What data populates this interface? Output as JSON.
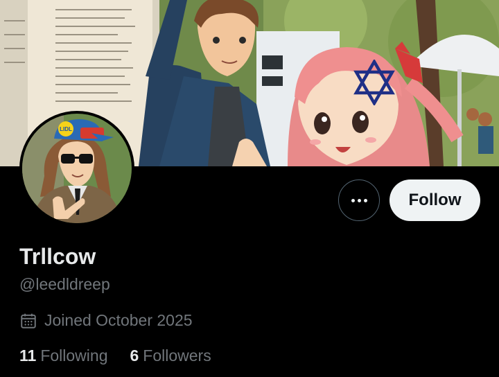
{
  "banner": {
    "alt": ""
  },
  "profile": {
    "display_name": "Trllcow",
    "handle": "@leedldreep",
    "joined": "Joined October 2025",
    "following_count": "11",
    "following_label": "Following",
    "followers_count": "6",
    "followers_label": "Followers"
  },
  "actions": {
    "more_icon": "more-horizontal-icon",
    "follow_label": "Follow"
  },
  "colors": {
    "background": "#000000",
    "primary_text": "#e7e9ea",
    "secondary_text": "#71767b",
    "follow_button_bg": "#eff3f4",
    "follow_button_text": "#0f1419"
  },
  "icons": {
    "calendar": "calendar-icon",
    "star_of_david": "star-of-david-icon"
  },
  "avatar": {
    "cap_logo_text": "LIDL"
  }
}
